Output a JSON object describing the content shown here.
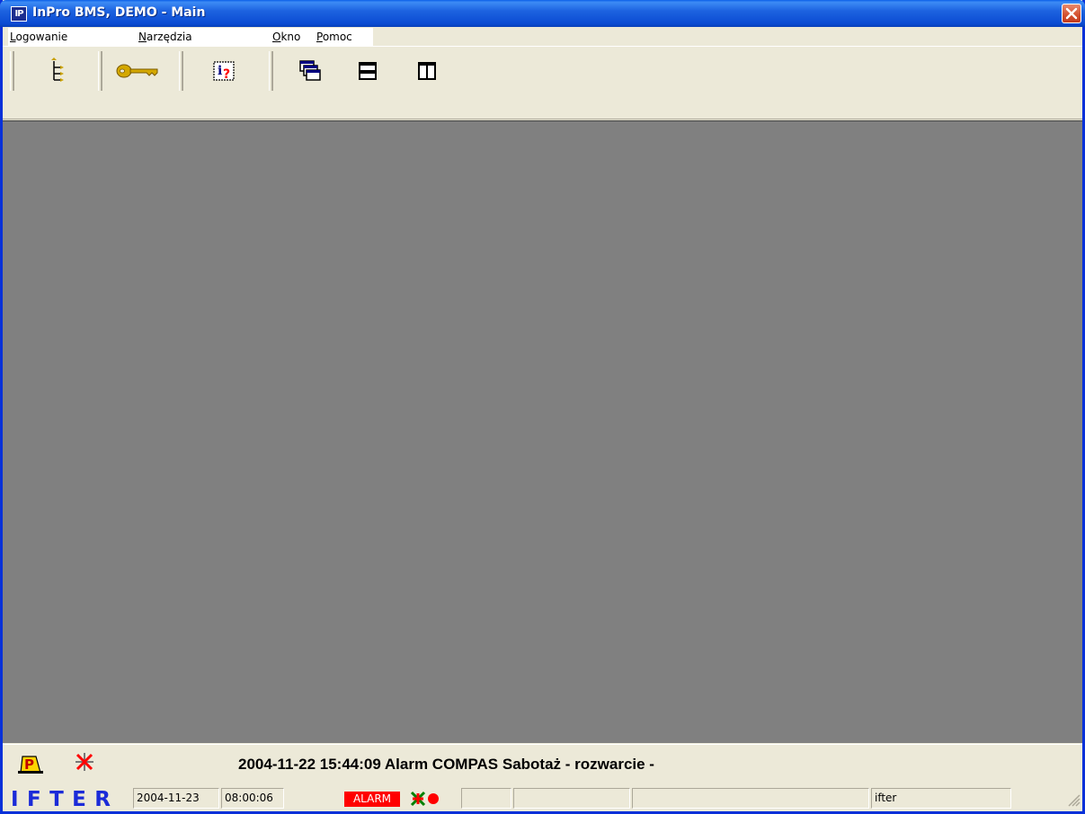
{
  "window": {
    "title": "InPro BMS, DEMO - Main",
    "app_icon": "IP"
  },
  "menubar": {
    "items": [
      {
        "label": "Logowanie"
      },
      {
        "label": "Narzędzia"
      },
      {
        "label": "Okno"
      },
      {
        "label": "Pomoc"
      }
    ]
  },
  "toolbar": {
    "buttons": [
      {
        "icon": "tree-view-icon"
      },
      {
        "icon": "key-icon"
      },
      {
        "icon": "info-help-icon"
      },
      {
        "icon": "cascade-windows-icon"
      },
      {
        "icon": "tile-horizontal-icon"
      },
      {
        "icon": "tile-vertical-icon"
      }
    ]
  },
  "alarm_bar": {
    "message": "2004-11-22 15:44:09  Alarm COMPAS Sabotaż - rozwarcie -",
    "icons": [
      "acknowledge-alarm-icon",
      "mute-alarm-icon"
    ]
  },
  "statusbar": {
    "logo": "IFTER",
    "date": "2004-11-23",
    "time": "08:00:06",
    "alarm_label": "ALARM",
    "user": "ifter"
  },
  "colors": {
    "titlebar": "#0b4bd2",
    "mdi_background": "#808080",
    "chrome": "#ece9d8",
    "alarm": "#ff0000",
    "logo": "#1b2bd8"
  }
}
